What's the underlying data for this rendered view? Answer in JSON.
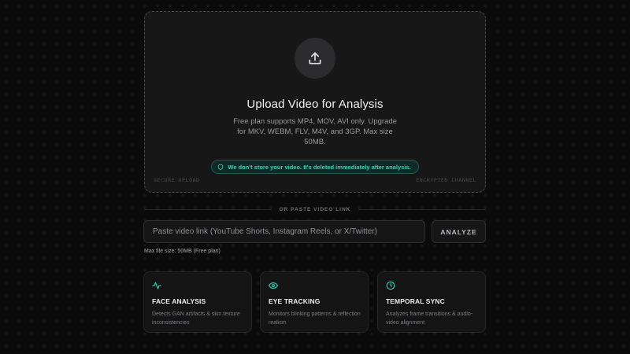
{
  "upload": {
    "title": "Upload Video for Analysis",
    "description": "Free plan supports MP4, MOV, AVI only. Upgrade for MKV, WEBM, FLV, M4V, and 3GP. Max size 50MB.",
    "privacy_note": "We don't store your video. It's deleted immediately after analysis.",
    "corner_left": "SECURE UPLOAD",
    "corner_right": "ENCRYPTED CHANNEL",
    "icon": "upload-icon"
  },
  "link": {
    "divider_text": "OR PASTE VIDEO LINK",
    "placeholder": "Paste video link (YouTube Shorts, Instagram Reels, or X/Twitter)",
    "value": "",
    "analyze_label": "ANALYZE",
    "max_size_note": "Max file size: 50MB (Free plan)"
  },
  "features": [
    {
      "title": "FACE ANALYSIS",
      "description": "Detects GAN artifacts & skin texture inconsistencies",
      "icon": "activity-icon"
    },
    {
      "title": "EYE TRACKING",
      "description": "Monitors blinking patterns & reflection realism",
      "icon": "eye-icon"
    },
    {
      "title": "TEMPORAL SYNC",
      "description": "Analyzes frame transitions & audio-video alignment",
      "icon": "clock-icon"
    }
  ],
  "colors": {
    "accent": "#2ec4ab",
    "background": "#0b0b0c",
    "panel": "#171718"
  }
}
